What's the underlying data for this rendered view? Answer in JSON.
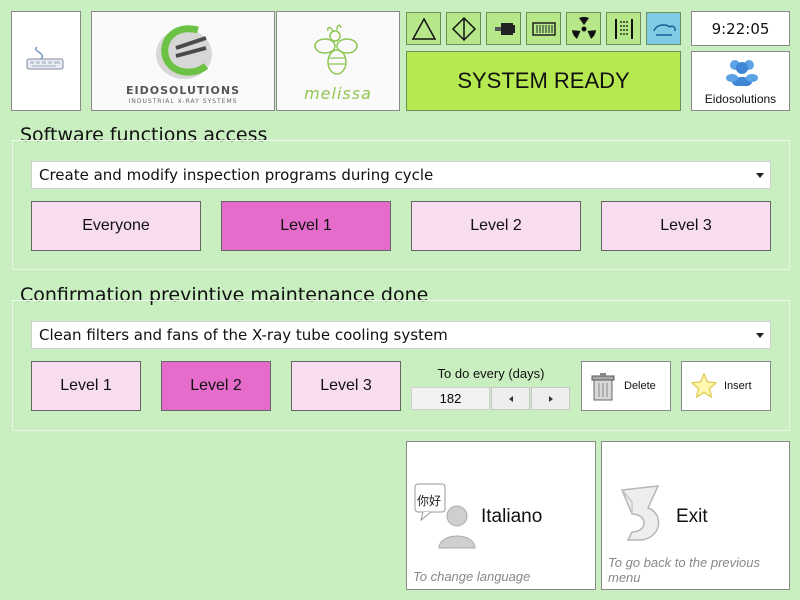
{
  "header": {
    "clock": "9:22:05",
    "status": "SYSTEM READY",
    "user_label": "Eidosolutions",
    "eido_logo_text": "EIDOSOLUTIONS",
    "eido_logo_subtext": "INDUSTRIAL X-RAY SYSTEMS",
    "melissa_logo_text": "melissa",
    "toolbar_icons": [
      "triangle-icon",
      "diamond-icon",
      "xray-source-icon",
      "detector-icon",
      "radiation-icon",
      "scan-bar-icon",
      "cloud-icon"
    ],
    "colors": {
      "status_bg": "#b6e84f",
      "icon_bg": "#b6e88a",
      "active_icon_bg": "#7fcbe4"
    }
  },
  "software_access": {
    "title": "Software functions access",
    "selected_function": "Create and modify inspection programs during cycle",
    "levels": [
      "Everyone",
      "Level 1",
      "Level 2",
      "Level 3"
    ],
    "selected_level": "Level 1"
  },
  "maintenance": {
    "title": "Confirmation previntive maintenance done",
    "selected_task": "Clean filters and fans of the X-ray tube cooling system",
    "levels": [
      "Level 1",
      "Level 2",
      "Level 3"
    ],
    "selected_level": "Level 2",
    "interval_label": "To do every (days)",
    "interval_value": "182",
    "delete_label": "Delete",
    "insert_label": "Insert"
  },
  "actions": {
    "language": {
      "label": "Italiano",
      "hint": "To change language",
      "bubble_text": "你好"
    },
    "exit": {
      "label": "Exit",
      "hint": "To go back to the previous menu"
    }
  },
  "colors": {
    "background": "#c9eec0",
    "level_normal": "#f8dcef",
    "level_selected": "#e66ccc"
  }
}
